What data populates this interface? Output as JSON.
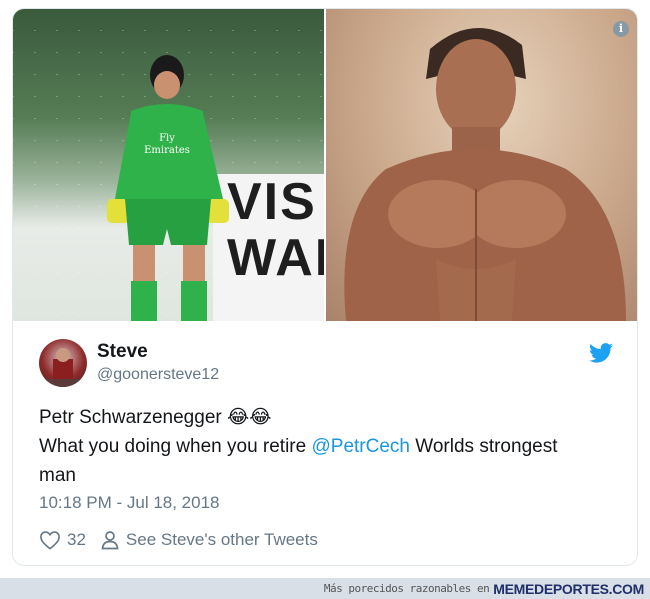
{
  "tweet": {
    "author": {
      "display_name": "Steve",
      "handle": "@goonersteve12"
    },
    "text": {
      "line1": "Petr Schwarzenegger",
      "line1_emoji": "😂😂",
      "line2_prefix": "What you doing when you retire ",
      "mention": "@PetrCech",
      "line2_suffix": " Worlds strongest",
      "line3": "man"
    },
    "timestamp": "10:18 PM - Jul 18, 2018",
    "like_count": "32",
    "other_tweets_label": "See Steve's other Tweets",
    "info_glyph": "i"
  },
  "media": {
    "left_board_text": [
      "VIS",
      "WAI"
    ],
    "shirt_text": [
      "Fly",
      "Emirates"
    ]
  },
  "footer": {
    "prefix": "Más porecidos razonables en",
    "brand": "MEMEDEPORTES.COM"
  },
  "colors": {
    "link": "#1b95e0",
    "twitter_blue": "#1da1f2",
    "secondary_text": "#657786",
    "keeper_kit": "#2fb24a"
  },
  "icons": [
    "info-icon",
    "twitter-bird-icon",
    "heart-icon",
    "person-icon"
  ]
}
